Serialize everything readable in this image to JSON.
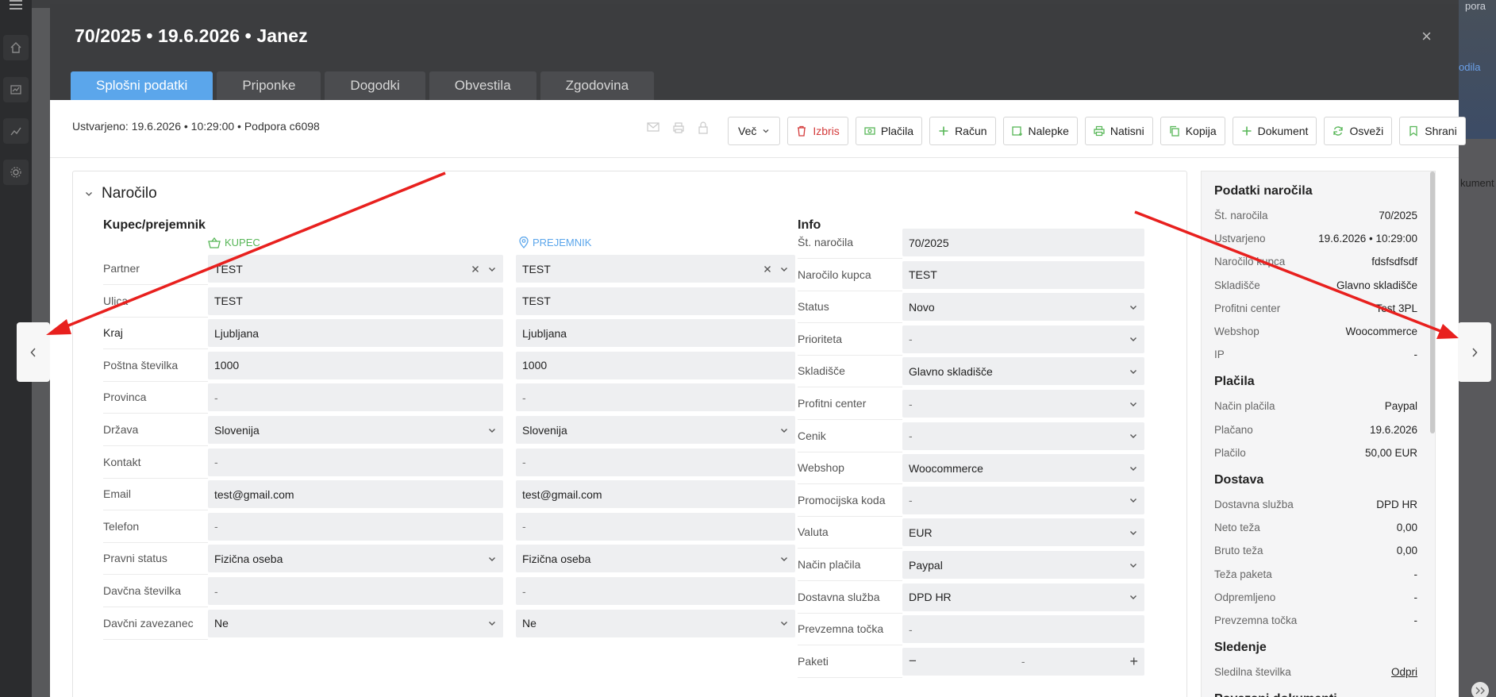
{
  "modal": {
    "title": "70/2025 • 19.6.2026 • Janez",
    "close": "×"
  },
  "tabs": [
    {
      "label": "Splošni podatki",
      "active": true
    },
    {
      "label": "Priponke"
    },
    {
      "label": "Dogodki"
    },
    {
      "label": "Obvestila"
    },
    {
      "label": "Zgodovina"
    }
  ],
  "toolbar": {
    "created": "Ustvarjeno: 19.6.2026 • 10:29:00 • Podpora c6098",
    "vec_label": "Več",
    "izbris_label": "Izbris",
    "placila_label": "Plačila",
    "racun_label": "Račun",
    "nalepke_label": "Nalepke",
    "natisni_label": "Natisni",
    "kopija_label": "Kopija",
    "dokument_label": "Dokument",
    "osvezi_label": "Osveži",
    "shrani_label": "Shrani"
  },
  "section": {
    "title": "Naročilo",
    "buyer_group": "Kupec/prejemnik",
    "kupec_label": "KUPEC",
    "prejemnik_label": "PREJEMNIK",
    "info_group": "Info"
  },
  "buyer_rows": [
    {
      "label": "Partner",
      "kupec": "TEST",
      "prejemnik": "TEST"
    },
    {
      "label": "Ulica",
      "kupec": "TEST",
      "prejemnik": "TEST"
    },
    {
      "label": "Kraj",
      "kupec": "Ljubljana",
      "prejemnik": "Ljubljana"
    },
    {
      "label": "Poštna številka",
      "kupec": "1000",
      "prejemnik": "1000"
    },
    {
      "label": "Provinca",
      "kupec": "-",
      "prejemnik": "-"
    },
    {
      "label": "Država",
      "kupec": "Slovenija",
      "prejemnik": "Slovenija"
    },
    {
      "label": "Kontakt",
      "kupec": "-",
      "prejemnik": "-"
    },
    {
      "label": "Email",
      "kupec": "test@gmail.com",
      "prejemnik": "test@gmail.com"
    },
    {
      "label": "Telefon",
      "kupec": "-",
      "prejemnik": "-"
    },
    {
      "label": "Pravni status",
      "kupec": "Fizična oseba",
      "prejemnik": "Fizična oseba"
    },
    {
      "label": "Davčna številka",
      "kupec": "-",
      "prejemnik": "-"
    },
    {
      "label": "Davčni zavezanec",
      "kupec": "Ne",
      "prejemnik": "Ne"
    }
  ],
  "info_rows": [
    {
      "label": "Št. naročila",
      "value": "70/2025"
    },
    {
      "label": "Naročilo kupca",
      "value": "TEST"
    },
    {
      "label": "Status",
      "value": "Novo"
    },
    {
      "label": "Prioriteta",
      "value": "-"
    },
    {
      "label": "Skladišče",
      "value": "Glavno skladišče"
    },
    {
      "label": "Profitni center",
      "value": "-"
    },
    {
      "label": "Cenik",
      "value": "-"
    },
    {
      "label": "Webshop",
      "value": "Woocommerce"
    },
    {
      "label": "Promocijska koda",
      "value": "-"
    },
    {
      "label": "Valuta",
      "value": "EUR"
    },
    {
      "label": "Način plačila",
      "value": "Paypal"
    },
    {
      "label": "Dostavna služba",
      "value": "DPD HR"
    },
    {
      "label": "Prevzemna točka",
      "value": "-"
    },
    {
      "label": "Paketi",
      "value": "-",
      "minus": "−",
      "plus": "+"
    }
  ],
  "side": {
    "h_podatki": "Podatki naročila",
    "h_placila": "Plačila",
    "h_dostava": "Dostava",
    "h_sledenje": "Sledenje",
    "h_povezani": "Povezani dokumenti",
    "podatki": [
      {
        "k": "Št. naročila",
        "v": "70/2025"
      },
      {
        "k": "Ustvarjeno",
        "v": "19.6.2026 • 10:29:00"
      },
      {
        "k": "Naročilo kupca",
        "v": "fdsfsdfsdf"
      },
      {
        "k": "Skladišče",
        "v": "Glavno skladišče"
      },
      {
        "k": "Profitni center",
        "v": "Test 3PL"
      },
      {
        "k": "Webshop",
        "v": "Woocommerce"
      },
      {
        "k": "IP",
        "v": "-"
      }
    ],
    "placila": [
      {
        "k": "Način plačila",
        "v": "Paypal"
      },
      {
        "k": "Plačano",
        "v": "19.6.2026"
      },
      {
        "k": "Plačilo",
        "v": "50,00 EUR"
      }
    ],
    "dostava": [
      {
        "k": "Dostavna služba",
        "v": "DPD HR"
      },
      {
        "k": "Neto teža",
        "v": "0,00"
      },
      {
        "k": "Bruto teža",
        "v": "0,00"
      },
      {
        "k": "Teža paketa",
        "v": "-"
      },
      {
        "k": "Odpremljeno",
        "v": "-"
      },
      {
        "k": "Prevzemna točka",
        "v": "-"
      }
    ],
    "sledenje": [
      {
        "k": "Sledilna številka",
        "v": "Odpri"
      }
    ]
  },
  "background": {
    "right_top": "pora",
    "right_link": "odila",
    "right_doc": "kument"
  },
  "nav": {
    "prev": "‹",
    "next": "›"
  },
  "colors": {
    "accent": "#5ba6eb",
    "kupec": "#57b657",
    "danger": "#d43b3b",
    "arrow": "#e8201e"
  }
}
